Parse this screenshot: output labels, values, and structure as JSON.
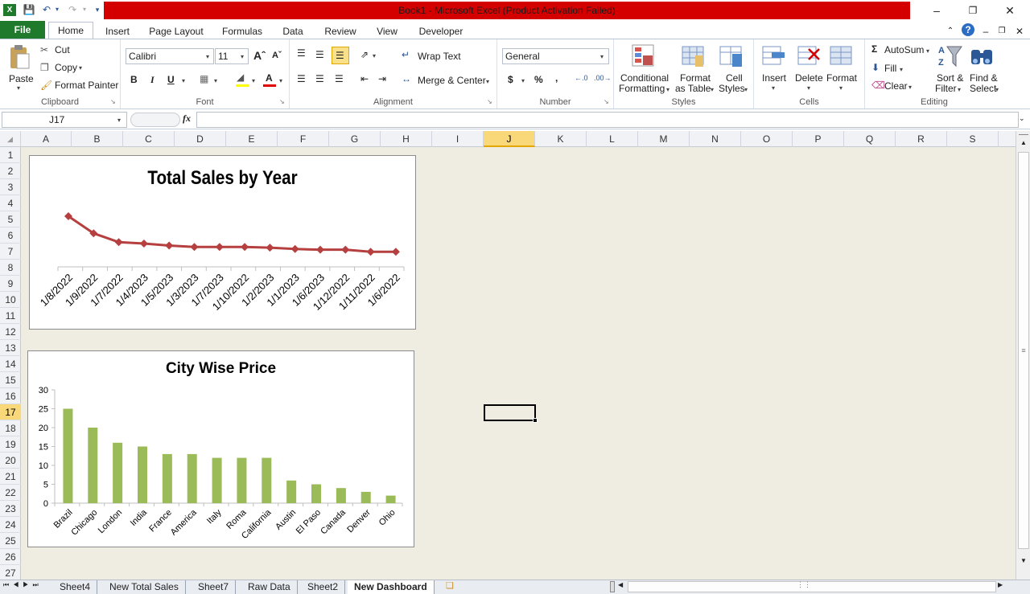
{
  "window": {
    "title": "Book1 - Microsoft Excel (Product Activation Failed)"
  },
  "ribbon_tabs": [
    "File",
    "Home",
    "Insert",
    "Page Layout",
    "Formulas",
    "Data",
    "Review",
    "View",
    "Developer"
  ],
  "clipboard": {
    "paste": "Paste",
    "cut": "Cut",
    "copy": "Copy",
    "format_painter": "Format Painter",
    "label": "Clipboard"
  },
  "font": {
    "name": "Calibri",
    "size": "11",
    "label": "Font",
    "bold": "B",
    "italic": "I",
    "underline": "U"
  },
  "alignment": {
    "wrap_text": "Wrap Text",
    "merge_center": "Merge & Center",
    "label": "Alignment"
  },
  "number": {
    "format": "General",
    "currency": "$",
    "percent": "%",
    "comma": ",",
    "label": "Number"
  },
  "styles": {
    "conditional": "Conditional",
    "conditional2": "Formatting",
    "format_as": "Format",
    "format_as2": "as Table",
    "cell": "Cell",
    "cell2": "Styles",
    "label": "Styles"
  },
  "cells": {
    "insert": "Insert",
    "delete": "Delete",
    "format": "Format",
    "label": "Cells"
  },
  "editing": {
    "autosum": "AutoSum",
    "fill": "Fill",
    "clear": "Clear",
    "sort": "Sort &",
    "sort2": "Filter",
    "find": "Find &",
    "find2": "Select",
    "label": "Editing"
  },
  "formula_bar": {
    "name_box": "J17",
    "fx": "fx",
    "value": ""
  },
  "columns": [
    "A",
    "B",
    "C",
    "D",
    "E",
    "F",
    "G",
    "H",
    "I",
    "J",
    "K",
    "L",
    "M",
    "N",
    "O",
    "P",
    "Q",
    "R",
    "S"
  ],
  "selected_column": "J",
  "selected_row": "17",
  "rows": [
    "1",
    "2",
    "3",
    "4",
    "5",
    "6",
    "7",
    "8",
    "9",
    "10",
    "11",
    "12",
    "13",
    "14",
    "15",
    "16",
    "17",
    "18",
    "19",
    "20",
    "21",
    "22",
    "23",
    "24",
    "25",
    "26",
    "27"
  ],
  "sheet_tabs": [
    "Sheet4",
    "New Total Sales",
    "Sheet7",
    "Raw Data",
    "Sheet2",
    "New Dashboard"
  ],
  "active_sheet": "New Dashboard",
  "colors": {
    "line": "#b5403f",
    "bar": "#9bbb59",
    "file_tab": "#1f7a2c",
    "title_bar": "#d40000"
  },
  "chart_data": [
    {
      "type": "line",
      "title": "Total Sales by Year",
      "categories": [
        "1/8/2022",
        "1/9/2022",
        "1/7/2022",
        "1/4/2023",
        "1/5/2023",
        "1/3/2023",
        "1/7/2023",
        "1/10/2022",
        "1/2/2023",
        "1/1/2023",
        "1/6/2023",
        "1/12/2022",
        "1/11/2022",
        "1/6/2022"
      ],
      "values": [
        100,
        75,
        62,
        60,
        57,
        55,
        55,
        55,
        54,
        52,
        51,
        51,
        48,
        48
      ],
      "y_axis_visible": false,
      "grid": false
    },
    {
      "type": "bar",
      "title": "City Wise Price",
      "categories": [
        "Brazil",
        "Chicago",
        "London",
        "India",
        "France",
        "America",
        "Italy",
        "Roma",
        "California",
        "Austin",
        "El Paso",
        "Canada",
        "Denver",
        "Ohio"
      ],
      "values": [
        25,
        20,
        16,
        15,
        13,
        13,
        12,
        12,
        12,
        6,
        5,
        4,
        3,
        2
      ],
      "ylim": [
        0,
        30
      ],
      "yticks": [
        "0",
        "5",
        "10",
        "15",
        "20",
        "25",
        "30"
      ],
      "grid": false
    }
  ]
}
